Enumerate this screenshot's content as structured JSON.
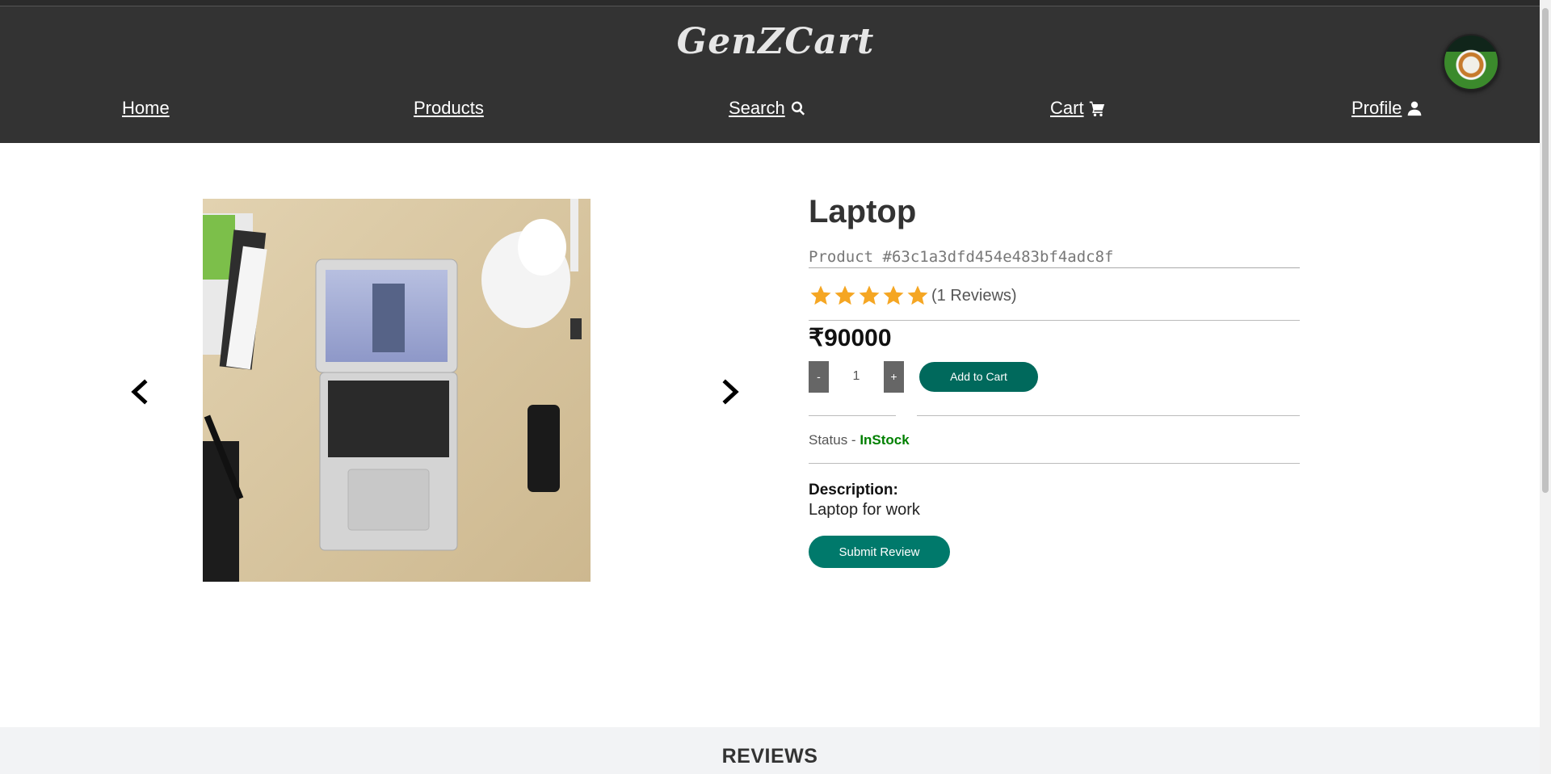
{
  "brand": {
    "name": "GenZCart"
  },
  "nav": {
    "home": "Home",
    "products": "Products",
    "search": "Search",
    "cart": "Cart",
    "profile": "Profile"
  },
  "product": {
    "title": "Laptop",
    "id_label": "Product #63c1a3dfd454e483bf4adc8f",
    "rating_stars": 5,
    "reviews_text": "(1 Reviews)",
    "price": "₹90000",
    "quantity": "1",
    "decrement": "-",
    "increment": "+",
    "add_to_cart": "Add to Cart",
    "status_label": "Status - ",
    "status_value": "InStock",
    "description_label": "Description:",
    "description": "Laptop for work",
    "submit_review": "Submit Review"
  },
  "reviews": {
    "heading": "REVIEWS"
  },
  "colors": {
    "header_bg": "#333333",
    "accent": "#00695c",
    "star": "#f5a623",
    "in_stock": "#008000"
  },
  "icons": [
    "search-icon",
    "cart-icon",
    "user-icon",
    "chevron-left-icon",
    "chevron-right-icon",
    "star-icon"
  ]
}
